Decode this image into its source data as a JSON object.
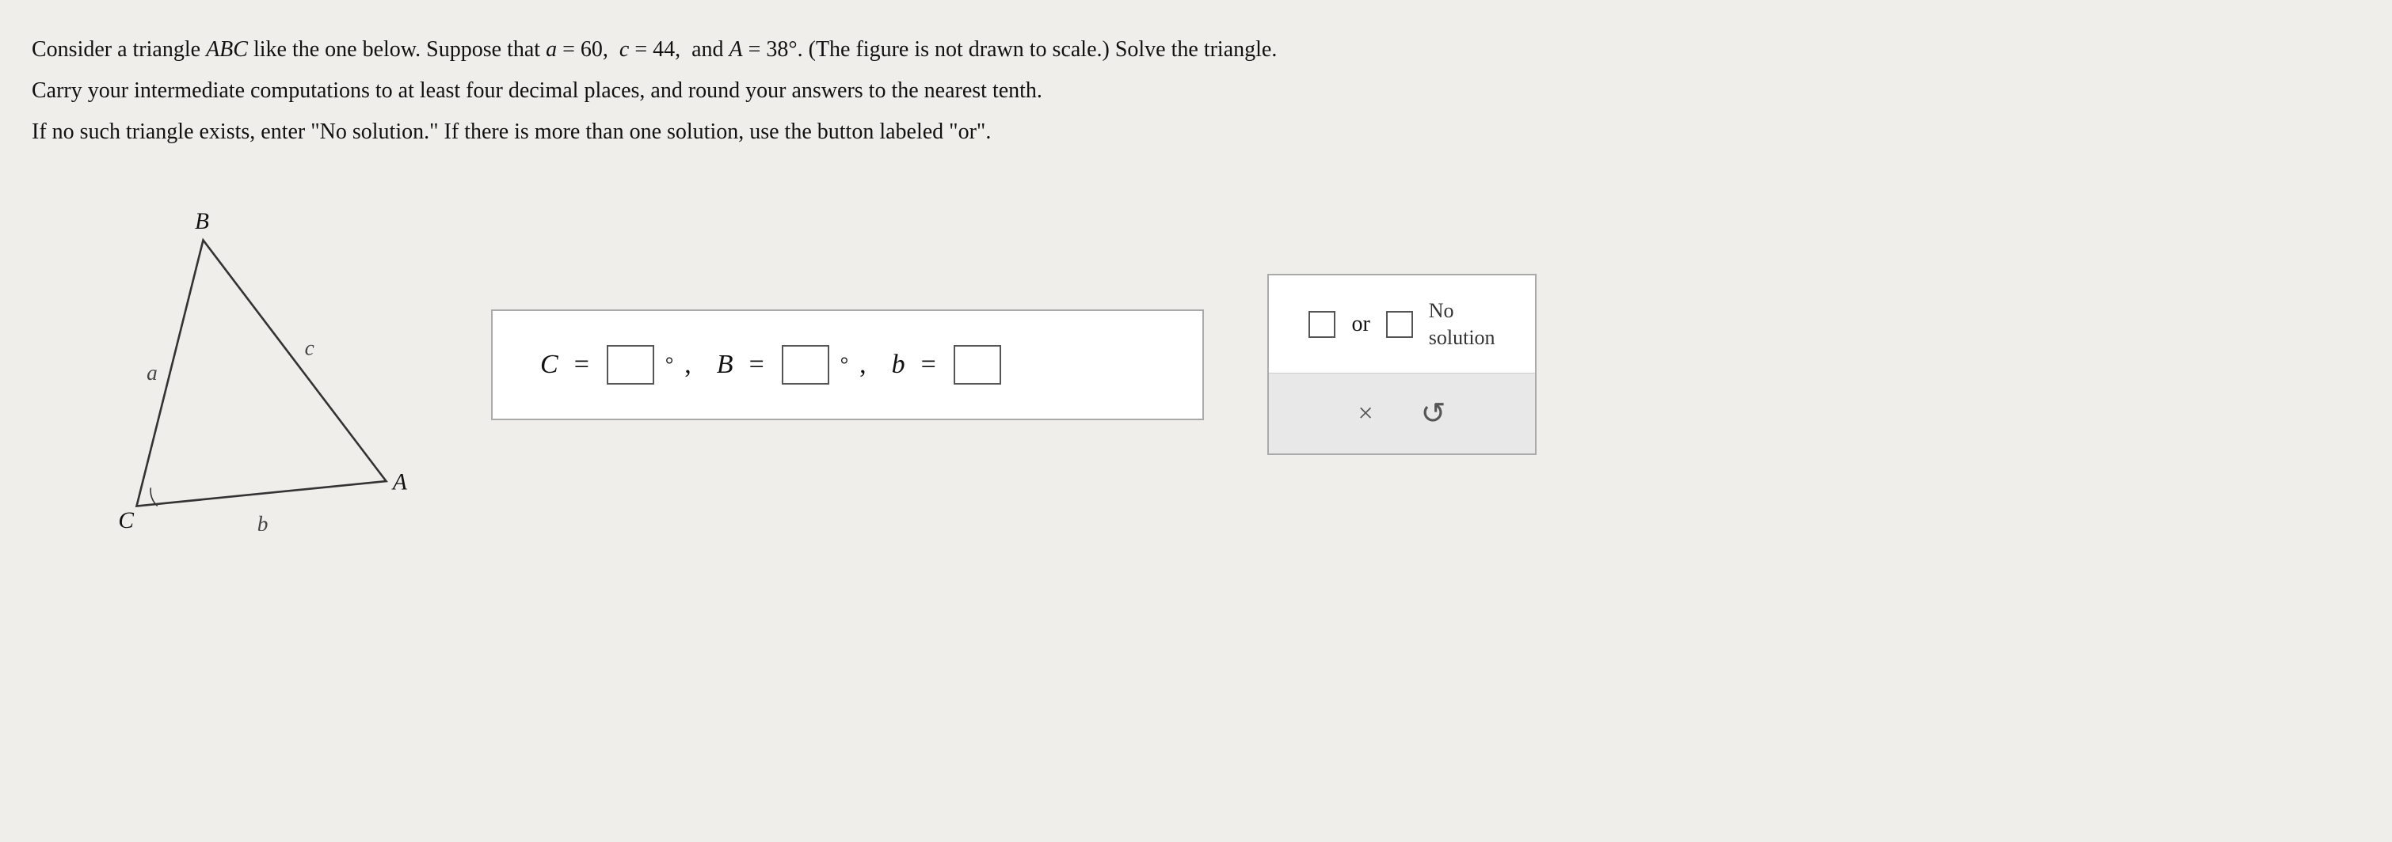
{
  "problem": {
    "line1": "Consider a triangle ABC like the one below. Suppose that a = 60,  c = 44,  and A = 38°. (The figure is not drawn to scale.) Solve the triangle.",
    "line2": "Carry your intermediate computations to at least four decimal places, and round your answers to the nearest tenth.",
    "line3": "If no such triangle exists, enter \"No solution.\" If there is more than one solution, use the button labeled \"or\"."
  },
  "triangle": {
    "vertex_b_label": "B",
    "vertex_a_label": "A",
    "vertex_c_label": "C",
    "side_a_label": "a",
    "side_b_label": "b",
    "side_c_label": "c"
  },
  "equation": {
    "c_label": "C",
    "b_label": "B",
    "b_side_label": "b",
    "equals": "=",
    "degree": "°",
    "comma": ","
  },
  "side_panel": {
    "or_label": "or",
    "no_solution_label": "No\nsolution",
    "clear_icon": "×",
    "undo_icon": "↺"
  }
}
